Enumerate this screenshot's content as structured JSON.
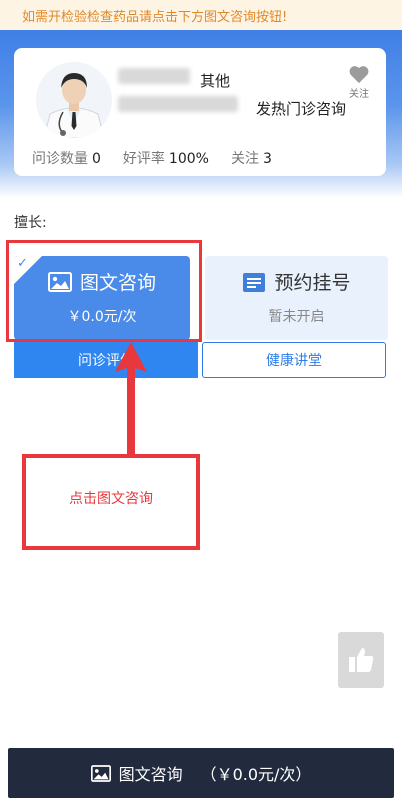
{
  "notice": {
    "text": "如需开检验检查药品请点击下方图文咨询按钮!"
  },
  "doctor": {
    "title": "其他",
    "department": "发热门诊咨询",
    "follow_label": "关注",
    "stats": [
      {
        "label": "问诊数量",
        "value": "0"
      },
      {
        "label": "好评率",
        "value": "100%"
      },
      {
        "label": "关注",
        "value": "3"
      }
    ]
  },
  "specialty": {
    "label": "擅长:"
  },
  "services": {
    "consult": {
      "title": "图文咨询",
      "price": "￥0.0元/次"
    },
    "appointment": {
      "title": "预约挂号",
      "status": "暂未开启"
    }
  },
  "tabs": {
    "review": "问诊评价",
    "lecture": "健康讲堂"
  },
  "annotation": {
    "text": "点击图文咨询"
  },
  "bottom_bar": {
    "label": "图文咨询",
    "price": "（￥0.0元/次）"
  },
  "colors": {
    "primary": "#2f86f0",
    "annotation_red": "#e8383d",
    "bottom_bar": "#222a3e",
    "notice_text": "#e0892b"
  }
}
